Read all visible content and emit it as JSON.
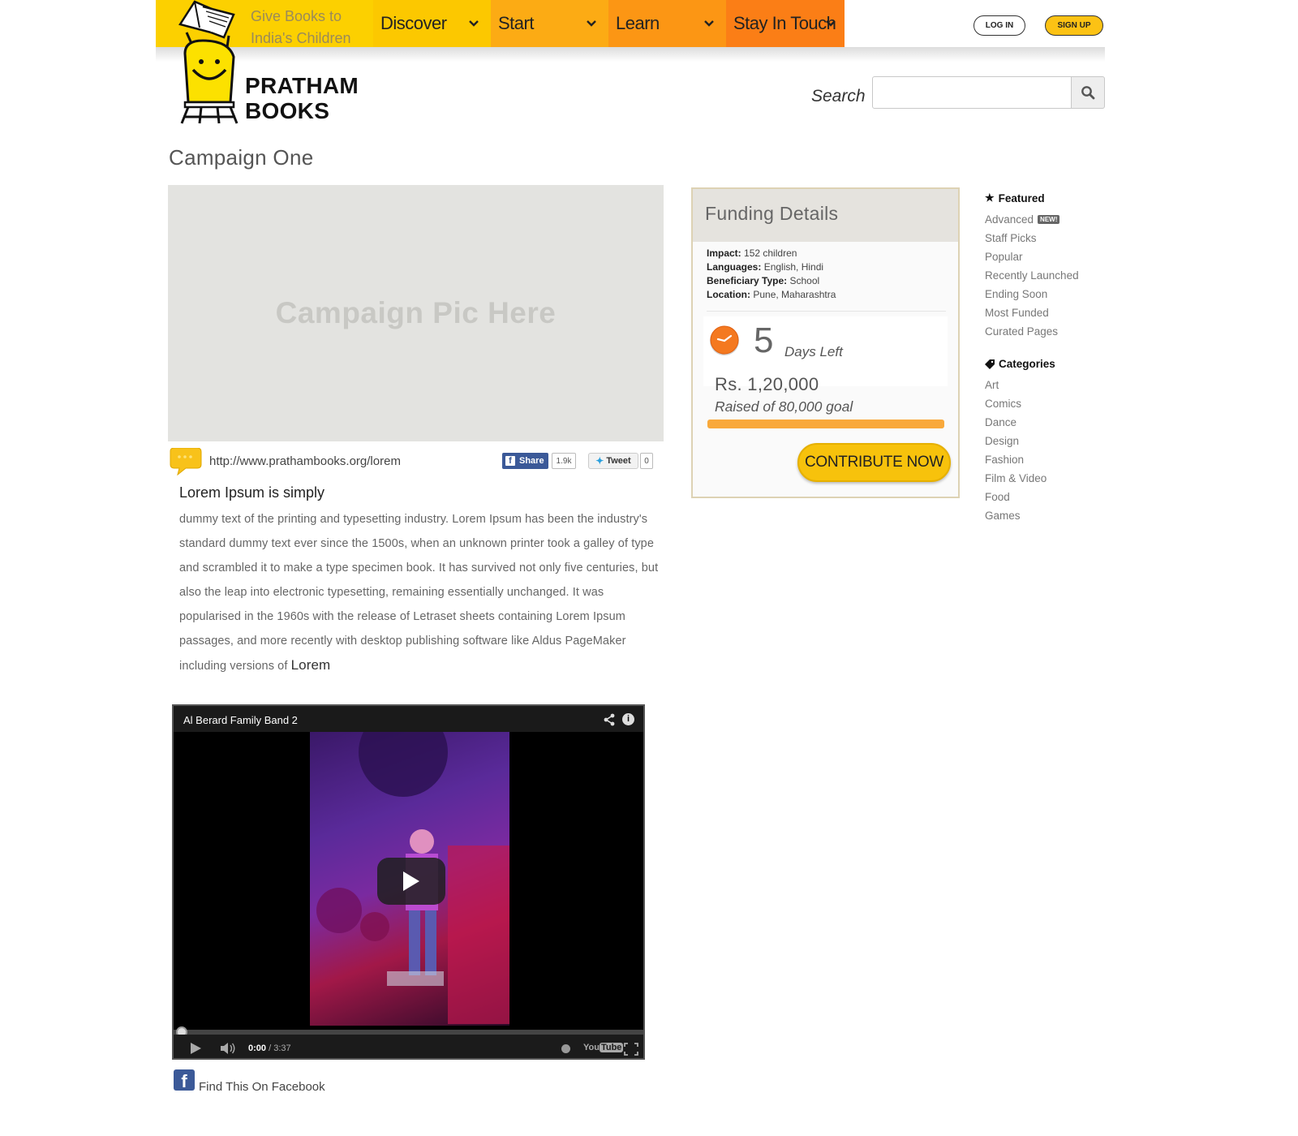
{
  "header": {
    "tagline": "Give Books to India's Children",
    "nav": [
      {
        "label": "Discover"
      },
      {
        "label": "Start"
      },
      {
        "label": "Learn"
      },
      {
        "label": "Stay In Touch"
      }
    ],
    "login_label": "LOG IN",
    "signup_label": "SIGN UP",
    "brand_line1": "PRATHAM",
    "brand_line2": "BOOKS",
    "search_label": "Search",
    "search_value": ""
  },
  "campaign": {
    "title": "Campaign One",
    "pic_placeholder": "Campaign Pic Here",
    "url": "http://www.prathambooks.org/lorem",
    "fb_share_label": "Share",
    "fb_share_count": "1.9k",
    "tweet_label": "Tweet",
    "tweet_count": "0",
    "lead": "Lorem Ipsum is simply",
    "body": "dummy text of the printing and typesetting industry. Lorem Ipsum has been the industry's standard dummy text ever since the 1500s, when an unknown printer took a galley of type and scrambled it to make a type specimen book. It has survived not only five centuries, but also the leap into electronic typesetting, remaining essentially unchanged. It was popularised in the 1960s with the release of Letraset sheets containing Lorem Ipsum passages, and more recently with desktop publishing software like Aldus PageMaker including versions of",
    "body_tail": "Lorem",
    "facebook_link": "Find This On Facebook"
  },
  "video": {
    "title": "Al Berard Family Band 2",
    "time_current": "0:00",
    "time_total": "/ 3:37",
    "progress": 0,
    "logo_you": "You",
    "logo_tube": "Tube"
  },
  "funding": {
    "title": "Funding Details",
    "impact_label": "Impact:",
    "impact_value": "152 children",
    "languages_label": "Languages:",
    "languages_value": "English, Hindi",
    "beneficiary_label": "Beneficiary Type:",
    "beneficiary_value": "School",
    "location_label": "Location:",
    "location_value": "Pune, Maharashtra",
    "days_left_number": "5",
    "days_left_label": "Days Left",
    "raised_amount": "Rs. 1,20,000",
    "raised_goal": "Raised of 80,000 goal",
    "progress_fraction": 1.0,
    "contribute_label": "CONTRIBUTE NOW"
  },
  "sidebar": {
    "featured_heading": "Featured",
    "featured": [
      {
        "label": "Advanced",
        "badge": "NEW!"
      },
      {
        "label": "Staff Picks"
      },
      {
        "label": "Popular"
      },
      {
        "label": "Recently Launched"
      },
      {
        "label": "Ending Soon"
      },
      {
        "label": "Most Funded"
      },
      {
        "label": "Curated Pages"
      }
    ],
    "categories_heading": "Categories",
    "categories": [
      {
        "label": "Art"
      },
      {
        "label": "Comics"
      },
      {
        "label": "Dance"
      },
      {
        "label": "Design"
      },
      {
        "label": "Fashion"
      },
      {
        "label": "Film & Video"
      },
      {
        "label": "Food"
      },
      {
        "label": "Games"
      }
    ]
  },
  "colors": {
    "brand_yellow": "#fcd000",
    "nav_orange": "#fb7e16",
    "progress_orange": "#f9a93b",
    "facebook_blue": "#3b5998"
  }
}
